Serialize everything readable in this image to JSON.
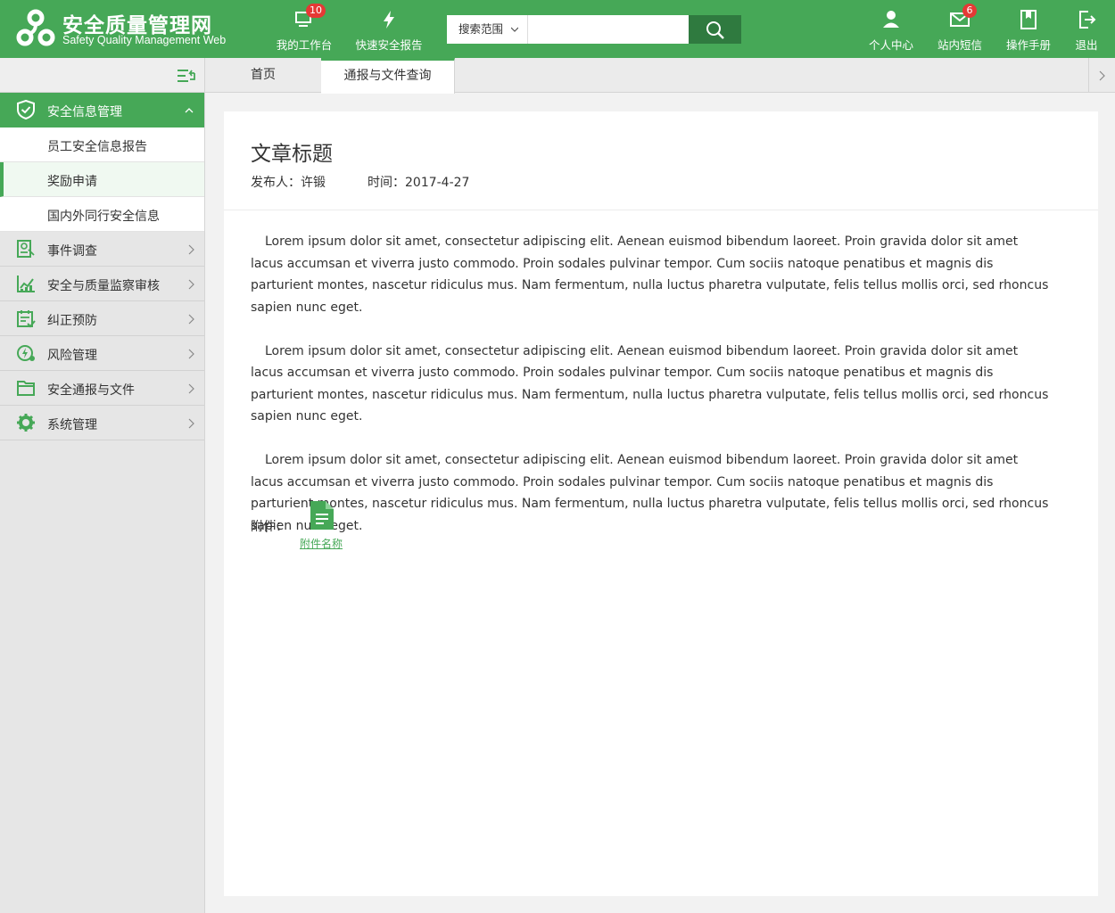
{
  "header": {
    "brand_cn": "安全质量管理网",
    "brand_en": "Safety Quality Management Web",
    "nav_left": [
      {
        "label": "我的工作台",
        "icon": "monitor-icon",
        "badge": "10"
      },
      {
        "label": "快速安全报告",
        "icon": "lightning-icon"
      }
    ],
    "search": {
      "scope_label": "搜索范围",
      "placeholder": ""
    },
    "nav_right": [
      {
        "label": "个人中心",
        "icon": "user-icon"
      },
      {
        "label": "站内短信",
        "icon": "mail-icon",
        "badge": "6"
      },
      {
        "label": "操作手册",
        "icon": "manual-icon"
      },
      {
        "label": "退出",
        "icon": "logout-icon"
      }
    ]
  },
  "sidebar": {
    "active_group": {
      "label": "安全信息管理",
      "icon": "shield-check-icon"
    },
    "sub_items": [
      {
        "label": "员工安全信息报告"
      },
      {
        "label": "奖励申请"
      },
      {
        "label": "国内外同行安全信息"
      }
    ],
    "items": [
      {
        "label": "事件调查",
        "icon": "investigation-icon"
      },
      {
        "label": "安全与质量监察审核",
        "icon": "audit-chart-icon"
      },
      {
        "label": "纠正预防",
        "icon": "calendar-check-icon"
      },
      {
        "label": "风险管理",
        "icon": "risk-icon"
      },
      {
        "label": "安全通报与文件",
        "icon": "folder-icon"
      },
      {
        "label": "系统管理",
        "icon": "gear-icon"
      }
    ]
  },
  "tabs": [
    {
      "label": "首页"
    },
    {
      "label": "通报与文件查询"
    }
  ],
  "article": {
    "title": "文章标题",
    "publisher": "发布人：许锻",
    "time": "时间：2017-4-27",
    "paragraphs": [
      "Lorem ipsum dolor sit amet, consectetur adipiscing elit. Aenean euismod bibendum laoreet. Proin gravida dolor sit amet lacus accumsan et viverra justo commodo. Proin sodales pulvinar tempor. Cum sociis natoque penatibus et magnis dis parturient montes, nascetur ridiculus mus. Nam fermentum, nulla luctus pharetra vulputate, felis tellus mollis orci, sed rhoncus sapien nunc eget.",
      "Lorem ipsum dolor sit amet, consectetur adipiscing elit. Aenean euismod bibendum laoreet. Proin gravida dolor sit amet lacus accumsan et viverra justo commodo. Proin sodales pulvinar tempor. Cum sociis natoque penatibus et magnis dis parturient montes, nascetur ridiculus mus. Nam fermentum, nulla luctus pharetra vulputate, felis tellus mollis orci, sed rhoncus sapien nunc eget.",
      "Lorem ipsum dolor sit amet, consectetur adipiscing elit. Aenean euismod bibendum laoreet. Proin gravida dolor sit amet lacus accumsan et viverra justo commodo. Proin sodales pulvinar tempor. Cum sociis natoque penatibus et magnis dis parturient montes, nascetur ridiculus mus. Nam fermentum, nulla luctus pharetra vulputate, felis tellus mollis orci, sed rhoncus sapien nunc eget."
    ],
    "attachment_label": "附件：",
    "attachment_name": "附件名称"
  },
  "colors": {
    "brand_green": "#46a857",
    "search_button": "#2f7a3f",
    "badge_red": "#e53935"
  }
}
